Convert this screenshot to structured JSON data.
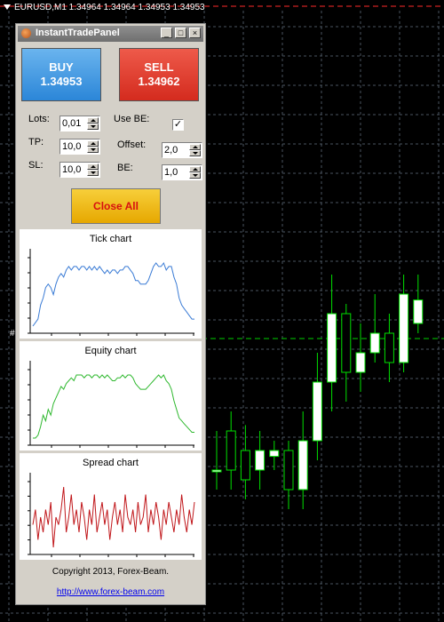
{
  "symbol_bar": "EURUSD,M1  1.34964 1.34964 1.34953 1.34953",
  "price_marker": "#",
  "panel": {
    "title": "InstantTradePanel",
    "buy": {
      "label": "BUY",
      "price": "1.34953",
      "color": "#2b86d8"
    },
    "sell": {
      "label": "SELL",
      "price": "1.34962",
      "color": "#d42b1e"
    },
    "fields": {
      "lots": {
        "label": "Lots:",
        "value": "0,01"
      },
      "tp": {
        "label": "TP:",
        "value": "10,0"
      },
      "sl": {
        "label": "SL:",
        "value": "10,0"
      },
      "use_be": {
        "label": "Use BE:",
        "checked": true
      },
      "offset": {
        "label": "Offset:",
        "value": "2,0"
      },
      "be": {
        "label": "BE:",
        "value": "1,0"
      }
    },
    "close_all": "Close All",
    "charts": {
      "tick": {
        "title": "Tick chart",
        "color": "#3a7bd5",
        "values": [
          62,
          63,
          64,
          68,
          70,
          73,
          74,
          73,
          71,
          74,
          76,
          77,
          76,
          78,
          79,
          78,
          79,
          79,
          78,
          79,
          79,
          78,
          79,
          78,
          79,
          78,
          79,
          78,
          77,
          78,
          77,
          78,
          78,
          77,
          78,
          78,
          79,
          79,
          78,
          77,
          75,
          75,
          74,
          74,
          74,
          75,
          77,
          79,
          80,
          79,
          79,
          80,
          78,
          79,
          79,
          76,
          74,
          70,
          68,
          67,
          66,
          65,
          64,
          64
        ]
      },
      "equity": {
        "title": "Equity chart",
        "color": "#2eb82e",
        "values": [
          38,
          38,
          39,
          42,
          46,
          44,
          48,
          46,
          50,
          52,
          54,
          56,
          55,
          57,
          58,
          59,
          58,
          60,
          60,
          60,
          59,
          60,
          60,
          59,
          60,
          60,
          59,
          60,
          59,
          60,
          59,
          58,
          58,
          59,
          59,
          60,
          59,
          60,
          60,
          59,
          57,
          56,
          55,
          55,
          55,
          56,
          57,
          58,
          59,
          60,
          59,
          60,
          58,
          57,
          55,
          51,
          48,
          45,
          44,
          43,
          42,
          41,
          40,
          40
        ]
      },
      "spread": {
        "title": "Spread chart",
        "color": "#c0161a",
        "values": [
          10,
          12,
          8,
          11,
          9,
          12,
          10,
          13,
          7,
          11,
          10,
          12,
          15,
          9,
          11,
          14,
          10,
          12,
          9,
          13,
          11,
          8,
          12,
          10,
          14,
          9,
          11,
          13,
          10,
          12,
          8,
          11,
          13,
          10,
          12,
          9,
          14,
          11,
          10,
          12,
          9,
          13,
          10,
          11,
          14,
          9,
          12,
          10,
          13,
          11,
          8,
          12,
          10,
          13,
          11,
          9,
          12,
          10,
          14,
          11,
          9,
          12,
          10,
          13
        ]
      }
    },
    "copyright": "Copyright 2013, Forex-Beam.",
    "link": "http://www.forex-beam.com"
  },
  "market": {
    "candles": [
      {
        "o": 0.05,
        "c": 0.05,
        "h": 0.25,
        "l": -0.05
      },
      {
        "o": 0.25,
        "c": 0.05,
        "h": 0.35,
        "l": -0.05
      },
      {
        "o": 0.15,
        "c": 0.0,
        "h": 0.28,
        "l": -0.1
      },
      {
        "o": 0.05,
        "c": 0.15,
        "h": 0.25,
        "l": -0.05
      },
      {
        "o": 0.12,
        "c": 0.15,
        "h": 0.2,
        "l": 0.05
      },
      {
        "o": 0.15,
        "c": -0.05,
        "h": 0.2,
        "l": -0.15
      },
      {
        "o": -0.05,
        "c": 0.2,
        "h": 0.35,
        "l": -0.15
      },
      {
        "o": 0.2,
        "c": 0.5,
        "h": 0.65,
        "l": 0.1
      },
      {
        "o": 0.5,
        "c": 0.85,
        "h": 1.05,
        "l": 0.35
      },
      {
        "o": 0.85,
        "c": 0.55,
        "h": 0.9,
        "l": 0.4
      },
      {
        "o": 0.55,
        "c": 0.65,
        "h": 0.8,
        "l": 0.45
      },
      {
        "o": 0.65,
        "c": 0.75,
        "h": 0.95,
        "l": 0.6
      },
      {
        "o": 0.75,
        "c": 0.6,
        "h": 0.85,
        "l": 0.5
      },
      {
        "o": 0.6,
        "c": 0.95,
        "h": 1.05,
        "l": 0.55
      },
      {
        "o": 0.8,
        "c": 0.92,
        "h": 1.05,
        "l": 0.75
      }
    ],
    "colors": {
      "grid": "#4a5560",
      "candle": "#00e000",
      "level": "#00d000"
    }
  }
}
